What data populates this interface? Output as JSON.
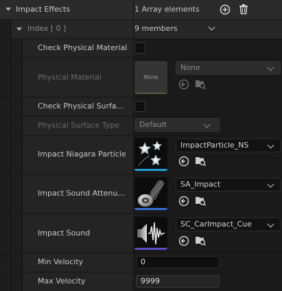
{
  "header": {
    "title": "Impact Effects",
    "array_count": "1 Array elements",
    "add_icon": "circle-plus-icon",
    "delete_icon": "trash-icon"
  },
  "index_row": {
    "label": "Index [ 0 ]",
    "members": "9 members"
  },
  "properties": {
    "check_physical_material": {
      "label": "Check Physical Material",
      "checked": false
    },
    "physical_material": {
      "label": "Physical Material",
      "thumb_text": "None",
      "value": "None",
      "enabled": false
    },
    "check_physical_surface": {
      "label": "Check Physical Surface Type",
      "display": "Check Physical Surface…",
      "checked": false
    },
    "physical_surface_type": {
      "label": "Physical Surface Type",
      "value": "Default",
      "enabled": false
    },
    "impact_niagara_particle": {
      "label": "Impact Niagara Particle",
      "value": "ImpactParticle_NS",
      "accent": "#1fa0d8"
    },
    "impact_sound_attenuation": {
      "label": "Impact Sound Attenuation",
      "display": "Impact Sound Attenuati…",
      "value": "SA_Impact",
      "accent": "#3a6fd0"
    },
    "impact_sound": {
      "label": "Impact Sound",
      "value": "SC_CarImpact_Cue",
      "accent": "#5a4ec6"
    },
    "min_velocity": {
      "label": "Min Velocity",
      "value": "0"
    },
    "max_velocity": {
      "label": "Max Velocity",
      "value": "9999"
    }
  },
  "colors": {
    "panel_bg": "#151515",
    "name_column": "#242424",
    "value_column": "#1a1a1a",
    "text": "#c8c8c8",
    "dim_text": "#6c6c6c"
  }
}
